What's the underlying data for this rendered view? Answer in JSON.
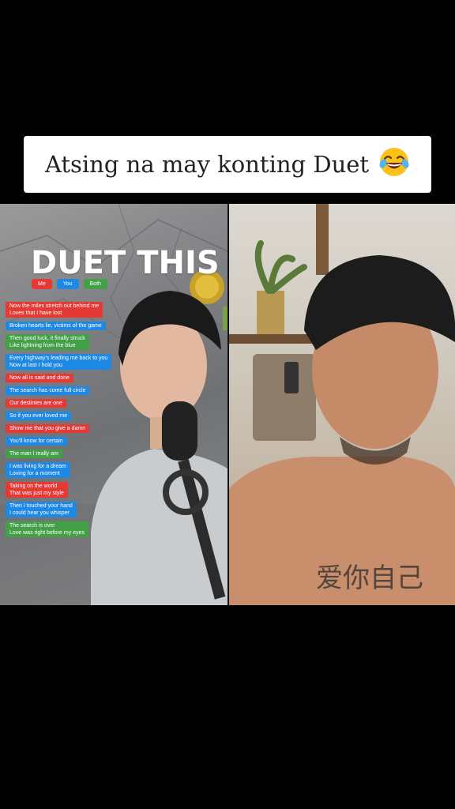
{
  "caption": {
    "text": "Atsing na may konting Duet",
    "emoji": "face-with-tears-of-joy"
  },
  "left_video": {
    "title": "DUET THIS",
    "legend": [
      {
        "label": "Me",
        "color": "#e53935"
      },
      {
        "label": "You",
        "color": "#1e88e5"
      },
      {
        "label": "Both",
        "color": "#43a047"
      }
    ],
    "lyrics": [
      {
        "text": "Now the miles stretch out behind me\nLoves that I have lost",
        "color": "#e53935"
      },
      {
        "text": "Broken hearts lie, victims of the game",
        "color": "#1e88e5"
      },
      {
        "text": "Then good luck, it finally struck\nLike lightning from the blue",
        "color": "#43a047"
      },
      {
        "text": "Every highway's leading me back to you\nNow at last I hold you",
        "color": "#1e88e5"
      },
      {
        "text": "Now all is said and done",
        "color": "#e53935"
      },
      {
        "text": "The search has come full circle",
        "color": "#1e88e5"
      },
      {
        "text": "Our destinies are one",
        "color": "#e53935"
      },
      {
        "text": "So if you ever loved me",
        "color": "#1e88e5"
      },
      {
        "text": "Show me that you give a damn",
        "color": "#e53935"
      },
      {
        "text": "You'll know for certain",
        "color": "#1e88e5"
      },
      {
        "text": "The man I really am",
        "color": "#43a047"
      },
      {
        "text": "I was living for a dream\nLoving for a moment",
        "color": "#1e88e5"
      },
      {
        "text": "Taking on the world\nThat was just my style",
        "color": "#e53935"
      },
      {
        "text": "Then I touched your hand\nI could hear you whisper",
        "color": "#1e88e5"
      },
      {
        "text": "The search is over\nLove was right before my eyes",
        "color": "#43a047"
      }
    ]
  },
  "colors": {
    "background": "#000000",
    "caption_bg": "#ffffff"
  }
}
